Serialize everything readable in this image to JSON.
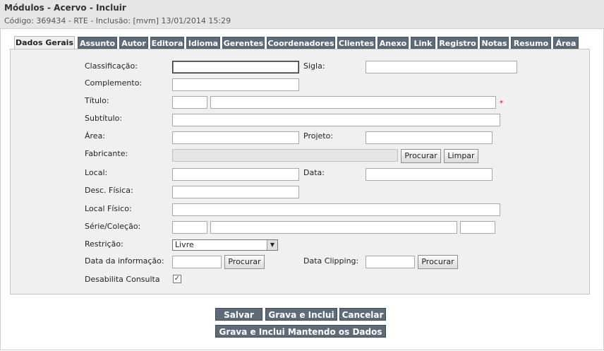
{
  "header": {
    "title": "Módulos - Acervo - Incluir",
    "subtitle": "Código: 369434 - RTE - Inclusão: [mvm] 13/01/2014 15:29"
  },
  "tabs": [
    "Dados Gerais",
    "Assunto",
    "Autor",
    "Editora",
    "Idioma",
    "Gerentes",
    "Coordenadores",
    "Clientes",
    "Anexo",
    "Link",
    "Registro",
    "Notas",
    "Resumo",
    "Área"
  ],
  "active_tab": "Dados Gerais",
  "form": {
    "classificacao": "Classificação:",
    "sigla": "Sigla:",
    "complemento": "Complemento:",
    "titulo": "Título:",
    "required_mark": "*",
    "subtitulo": "Subtítulo:",
    "area": "Área:",
    "projeto": "Projeto:",
    "fabricante": "Fabricante:",
    "procurar": "Procurar",
    "limpar": "Limpar",
    "local": "Local:",
    "data": "Data:",
    "desc_fisica": "Desc. Física:",
    "local_fisico": "Local Físico:",
    "serie_colecao": "Série/Coleção:",
    "restricao": "Restrição:",
    "restricao_value": "Livre",
    "data_informacao": "Data da informação:",
    "data_clipping": "Data Clipping:",
    "desabilita_consulta": "Desabilita Consulta",
    "desabilita_checked": "✓"
  },
  "actions": {
    "salvar": "Salvar",
    "grava_inclui": "Grava e Inclui",
    "cancelar": "Cancelar",
    "grava_inclui_mantendo": "Grava e Inclui Mantendo os Dados"
  }
}
